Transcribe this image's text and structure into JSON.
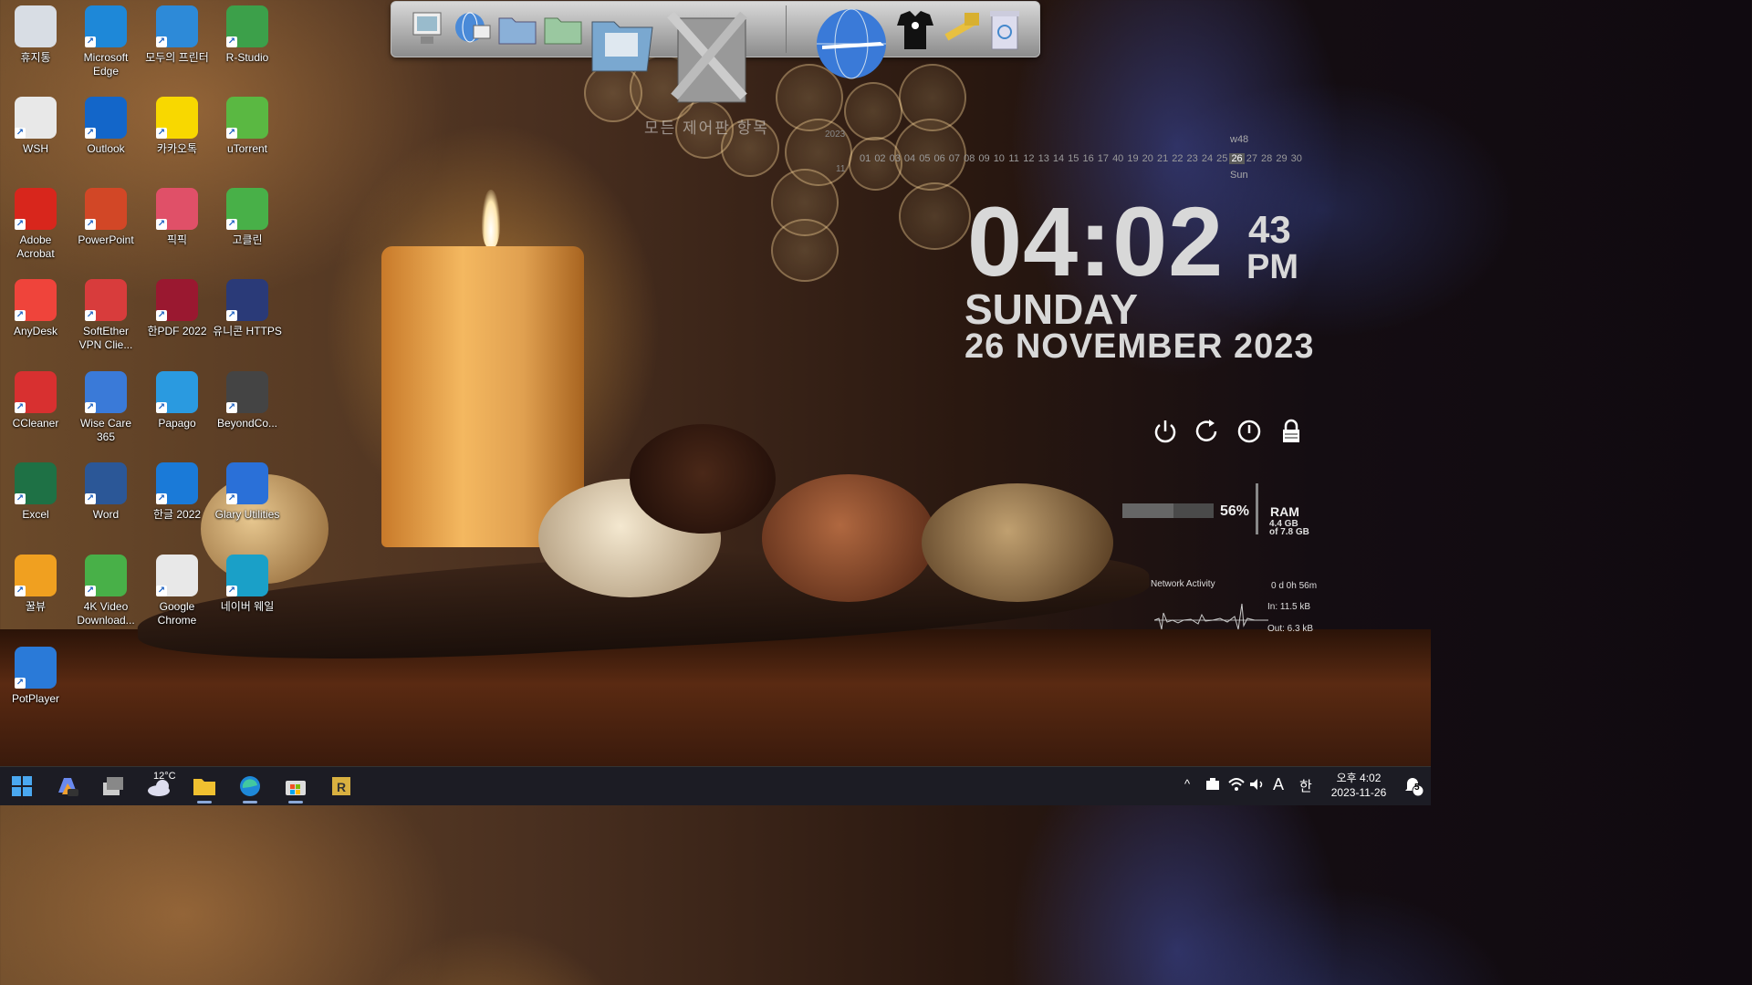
{
  "desktop_icons": [
    {
      "label": "휴지통",
      "icon": "recycle-bin-icon",
      "color": "#d8dde4"
    },
    {
      "label": "Microsoft Edge",
      "icon": "edge-icon",
      "color": "#1e88d8"
    },
    {
      "label": "모두의 프린터",
      "icon": "printer-icon",
      "color": "#2d8ad8"
    },
    {
      "label": "R-Studio",
      "icon": "rstudio-icon",
      "color": "#3ca04a"
    },
    {
      "label": "WSH",
      "icon": "document-icon",
      "color": "#e8e8e8"
    },
    {
      "label": "Outlook",
      "icon": "outlook-icon",
      "color": "#1366c9"
    },
    {
      "label": "카카오톡",
      "icon": "kakaotalk-icon",
      "color": "#f8d800"
    },
    {
      "label": "uTorrent",
      "icon": "utorrent-icon",
      "color": "#5ab842"
    },
    {
      "label": "Adobe Acrobat",
      "icon": "acrobat-icon",
      "color": "#d8261c"
    },
    {
      "label": "PowerPoint",
      "icon": "powerpoint-icon",
      "color": "#d24726"
    },
    {
      "label": "픽픽",
      "icon": "picpick-icon",
      "color": "#e05068"
    },
    {
      "label": "고클린",
      "icon": "goclean-icon",
      "color": "#48b048"
    },
    {
      "label": "AnyDesk",
      "icon": "anydesk-icon",
      "color": "#ef443b"
    },
    {
      "label": "SoftEther VPN Clie...",
      "icon": "softether-icon",
      "color": "#d83c3c"
    },
    {
      "label": "한PDF 2022",
      "icon": "hanpdf-icon",
      "color": "#9a1830"
    },
    {
      "label": "유니콘 HTTPS",
      "icon": "unicorn-icon",
      "color": "#2a3a78"
    },
    {
      "label": "CCleaner",
      "icon": "ccleaner-icon",
      "color": "#d83030"
    },
    {
      "label": "Wise Care 365",
      "icon": "wisecare-icon",
      "color": "#3a7ad8"
    },
    {
      "label": "Papago",
      "icon": "papago-icon",
      "color": "#2a9ae0"
    },
    {
      "label": "BeyondCo...",
      "icon": "beyondcompare-icon",
      "color": "#444"
    },
    {
      "label": "Excel",
      "icon": "excel-icon",
      "color": "#1e7145"
    },
    {
      "label": "Word",
      "icon": "word-icon",
      "color": "#2b5797"
    },
    {
      "label": "한글 2022",
      "icon": "hangul-icon",
      "color": "#1a7ad8"
    },
    {
      "label": "Glary Utilities",
      "icon": "glary-icon",
      "color": "#2a70d8"
    },
    {
      "label": "꿀뷰",
      "icon": "honeyview-icon",
      "color": "#f0a020"
    },
    {
      "label": "4K Video Download...",
      "icon": "4k-downloader-icon",
      "color": "#48b048"
    },
    {
      "label": "Google Chrome",
      "icon": "chrome-icon",
      "color": "#e8e8e8"
    },
    {
      "label": "네이버 웨일",
      "icon": "whale-icon",
      "color": "#1aa0c8"
    },
    {
      "label": "PotPlayer",
      "icon": "potplayer-icon",
      "color": "#2a7ad8"
    }
  ],
  "dock": {
    "items": [
      "computer-icon",
      "network-globe-icon",
      "folder-icon",
      "green-folder-icon",
      "pictures-folder-icon",
      "control-panel-tools-icon",
      "internet-globe-icon",
      "tshirt-icon",
      "hammer-icon",
      "trash-icon"
    ],
    "caption": "모든 제어판 항목"
  },
  "calendar": {
    "year": "2023",
    "month": "11",
    "week": "w48",
    "days": [
      "01",
      "02",
      "03",
      "04",
      "05",
      "06",
      "07",
      "08",
      "09",
      "10",
      "11",
      "12",
      "13",
      "14",
      "15",
      "16",
      "17",
      "40",
      "19",
      "20",
      "21",
      "22",
      "23",
      "24",
      "25",
      "26",
      "27",
      "28",
      "29",
      "30"
    ],
    "today": "26",
    "today_name": "Sun"
  },
  "clock": {
    "time": "04:02",
    "seconds": "43",
    "ampm": "PM",
    "day": "SUNDAY",
    "date": "26 NOVEMBER 2023"
  },
  "power_controls": [
    "power-icon",
    "restart-icon",
    "logoff-icon",
    "lock-icon"
  ],
  "ram": {
    "percent": "56%",
    "label": "RAM",
    "used": "4.4 GB",
    "total": "of 7.8 GB",
    "fill": 0.56
  },
  "network": {
    "title": "Network Activity",
    "uptime": "0 d 0h 56m",
    "in": "In: 11.5 kB",
    "out": "Out: 6.3 kB"
  },
  "taskbar": {
    "items": [
      "start-icon",
      "copilot-icon",
      "task-view-icon",
      "weather-icon",
      "file-explorer-icon",
      "edge-icon",
      "store-icon",
      "rstudio-taskbar-icon"
    ],
    "weather_temp": "12°C",
    "tray": {
      "chevron": "^",
      "ime_mode": "A",
      "ime_lang": "한",
      "time": "오후 4:02",
      "date": "2023-11-26",
      "notifications": "5"
    }
  },
  "colors": {
    "taskbar_bg": "#1c1c24",
    "clock_text": "#d8d8d8"
  }
}
